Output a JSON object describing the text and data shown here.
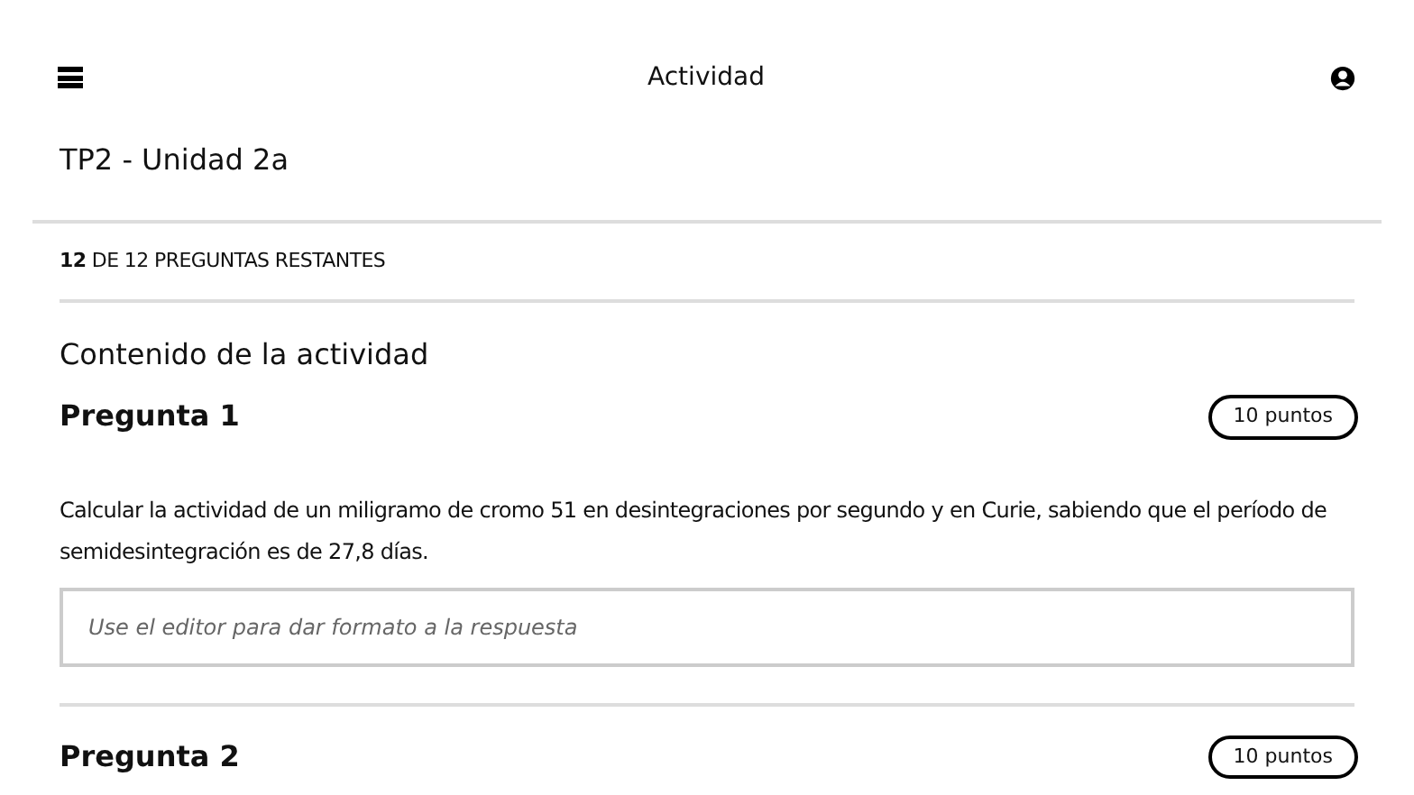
{
  "header": {
    "title": "Actividad"
  },
  "activity_title": "TP2 - Unidad 2a",
  "progress": "**12** DE 12 PREGUNTAS RESTANTES",
  "section_title": "Contenido de la actividad",
  "questions": [
    {
      "title": "Pregunta 1",
      "points": "10 puntos",
      "text": "Calcular la actividad de un miligramo de cromo 51 en desintegraciones por segundo y en Curie, sabiendo que el período de semidesintegración es de 27,8 días.",
      "answer": {
        "placeholder": "Use el editor para dar formato a la respuesta"
      }
    },
    {
      "title": "Pregunta 2",
      "points": "10 puntos"
    }
  ]
}
